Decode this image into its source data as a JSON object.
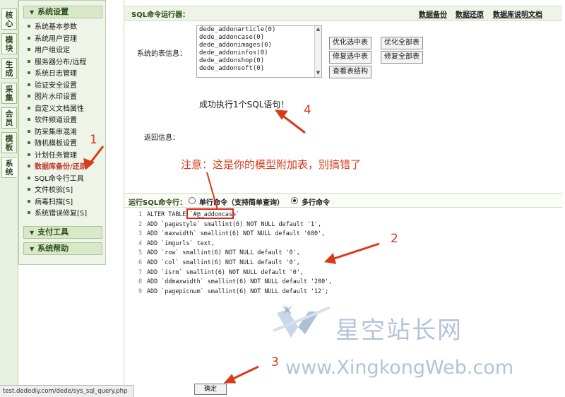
{
  "vtabs": [
    "核心",
    "模块",
    "生成",
    "采集",
    "会员",
    "模板",
    "系统"
  ],
  "menu": {
    "header": "系统设置",
    "items": [
      "系统基本参数",
      "系统用户管理",
      "用户组设定",
      "服务器分布/远程",
      "系统日志管理",
      "验证安全设置",
      "图片水印设置",
      "自定义文档属性",
      "软件频道设置",
      "防采集串混淆",
      "随机模板设置",
      "计划任务管理",
      "数据库备份/还原",
      "SQL命令行工具",
      "文件校验[S]",
      "病毒扫描[S]",
      "系统错误修复[S]"
    ],
    "active_index": 12,
    "header2": "支付工具",
    "header3": "系统帮助"
  },
  "main": {
    "title": "SQL命令运行器：",
    "links": [
      "数据备份",
      "数据还原",
      "数据库说明文档"
    ],
    "table_label": "系统的表信息：",
    "tables": [
      "dede_addonarticle(0)",
      "dede_addoncase(0)",
      "dede_addonimages(0)",
      "dede_addoninfos(0)",
      "dede_addonshop(0)",
      "dede_addonsoft(0)"
    ],
    "buttons": {
      "optimize_selected": "优化选中表",
      "optimize_all": "优化全部表",
      "repair_selected": "修复选中表",
      "repair_all": "修复全部表",
      "view_structure": "查看表结构"
    },
    "return_label": "返回信息：",
    "success_message": "成功执行1个SQL语句！",
    "mode_label": "运行SQL命令行：",
    "mode_single": "单行命令（支持简单查询）",
    "mode_multi": "多行命令",
    "mode_selected": "multi",
    "code_lines": [
      "ALTER TABLE `#@_addoncase`",
      "ADD `pagestyle` smallint(6) NOT NULL default '1',",
      "ADD `maxwidth` smallint(6) NOT NULL default '600',",
      "ADD `imgurls` text,",
      "ADD `row` smallint(6) NOT NULL default '0',",
      "ADD `col` smallint(6) NOT NULL default '0',",
      "ADD `isrm` smallint(6) NOT NULL default '0',",
      "ADD `ddmaxwidth` smallint(6) NOT NULL default '200',",
      "ADD `pagepicnum` smallint(6) NOT NULL default '12';"
    ],
    "ok_button": "确定"
  },
  "annotations": {
    "note": "注意：这是你的模型附加表，别搞错了",
    "n1": "1",
    "n2": "2",
    "n3": "3",
    "n4": "4",
    "color": "#d93a1a"
  },
  "status_url": "test.dedediy.com/dede/sys_sql_query.php",
  "watermark": {
    "text": "星空站长网",
    "url": "www.XingkongWeb.com"
  }
}
